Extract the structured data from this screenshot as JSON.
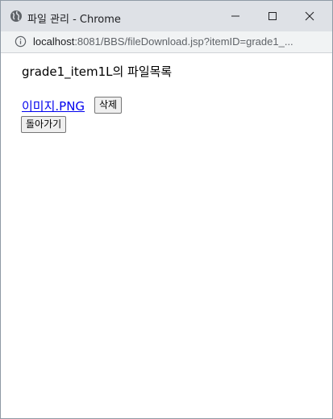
{
  "window": {
    "title": "파일 관리 - Chrome"
  },
  "address_bar": {
    "host": "localhost",
    "path": ":8081/BBS/fileDownload.jsp?itemID=grade1_..."
  },
  "page": {
    "heading": "grade1_item1L의 파일목록",
    "files": [
      {
        "name": "이미지.PNG",
        "delete_label": "삭제"
      }
    ],
    "back_label": "돌아가기"
  },
  "colors": {
    "titlebar": "#dee1e6",
    "link": "#0000ee"
  }
}
